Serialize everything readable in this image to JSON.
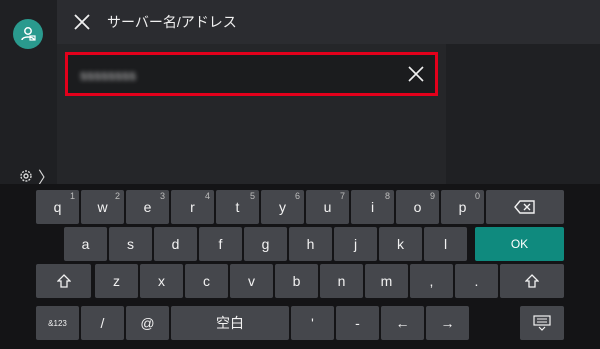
{
  "header": {
    "title": "サーバー名/アドレス"
  },
  "input": {
    "value": "ssssssss"
  },
  "keyboard": {
    "row1": [
      {
        "label": "q",
        "hint": "1"
      },
      {
        "label": "w",
        "hint": "2"
      },
      {
        "label": "e",
        "hint": "3"
      },
      {
        "label": "r",
        "hint": "4"
      },
      {
        "label": "t",
        "hint": "5"
      },
      {
        "label": "y",
        "hint": "6"
      },
      {
        "label": "u",
        "hint": "7"
      },
      {
        "label": "i",
        "hint": "8"
      },
      {
        "label": "o",
        "hint": "9"
      },
      {
        "label": "p",
        "hint": "0"
      }
    ],
    "row2": [
      "a",
      "s",
      "d",
      "f",
      "g",
      "h",
      "j",
      "k",
      "l"
    ],
    "row3": [
      "z",
      "x",
      "c",
      "v",
      "b",
      "n",
      "m",
      ",",
      "."
    ],
    "ok_label": "OK",
    "symbols_label": "&123",
    "slash": "/",
    "at": "@",
    "space_label": "空白",
    "apostrophe": "'",
    "dash": "-",
    "left_arrow": "←",
    "right_arrow": "→"
  },
  "settings": {
    "chevron": "〉"
  },
  "icons": [
    "user-icon",
    "gear-icon",
    "close-icon",
    "clear-icon",
    "backspace-icon",
    "shift-icon",
    "keyboard-hide-icon"
  ]
}
